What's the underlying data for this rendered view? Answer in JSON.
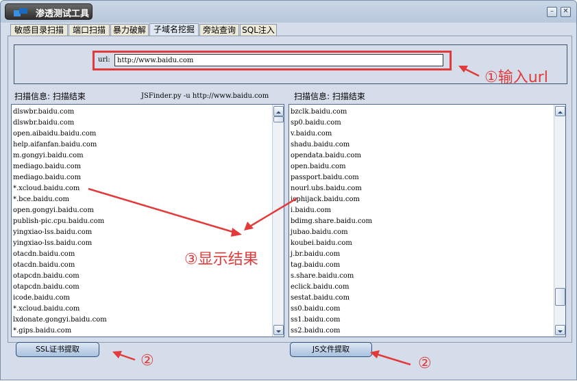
{
  "window": {
    "title": "渗透测试工具"
  },
  "tabs": [
    {
      "label": "敏感目录扫描"
    },
    {
      "label": "端口扫描"
    },
    {
      "label": "暴力破解"
    },
    {
      "label": "子域名挖掘"
    },
    {
      "label": "旁站查询"
    },
    {
      "label": "SQL注入"
    }
  ],
  "active_tab": "子域名挖掘",
  "url": {
    "label": "url:",
    "value": "http://www.baidu.com"
  },
  "left": {
    "info": "扫描信息: 扫描结束",
    "command": "JSFinder.py -u http://www.baidu.com",
    "items": [
      "dlswbr.baidu.com",
      "dlswbr.baidu.com",
      "open.aibaidu.baidu.com",
      "help.aifanfan.baidu.com",
      "m.gongyi.baidu.com",
      "mediago.baidu.com",
      "mediago.baidu.com",
      "*.xcloud.baidu.com",
      "*.bce.baidu.com",
      "open.gongyi.baidu.com",
      "publish-pic.cpu.baidu.com",
      "yingxiao-lss.baidu.com",
      "yingxiao-lss.baidu.com",
      "otacdn.baidu.com",
      "otacdn.baidu.com",
      "otapcdn.baidu.com",
      "otapcdn.baidu.com",
      "icode.baidu.com",
      "*.xcloud.baidu.com",
      "lxdonate.gongyi.baidu.com",
      "*.gips.baidu.com"
    ],
    "button": "SSL证书提取"
  },
  "right": {
    "info": "扫描信息: 扫描结束",
    "items": [
      "bzclk.baidu.com",
      "sp0.baidu.com",
      "v.baidu.com",
      "shadu.baidu.com",
      "opendata.baidu.com",
      "open.baidu.com",
      "passport.baidu.com",
      "nourl.ubs.baidu.com",
      "isphijack.baidu.com",
      "i.baidu.com",
      "bdimg.share.baidu.com",
      "jubao.baidu.com",
      "koubei.baidu.com",
      "j.br.baidu.com",
      "tag.baidu.com",
      "s.share.baidu.com",
      "eclick.baidu.com",
      "sestat.baidu.com",
      "ss0.baidu.com",
      "ss1.baidu.com",
      "ss2.baidu.com"
    ],
    "button": "JS文件提取"
  },
  "annotations": {
    "input_url": "①输入url",
    "show_result": "③显示结果",
    "step2_left": "②",
    "step2_right": "②"
  },
  "colors": {
    "annotation": "#e23a3a",
    "window_bg": "#d4dde9",
    "title_bg": "#3a3a3a"
  }
}
